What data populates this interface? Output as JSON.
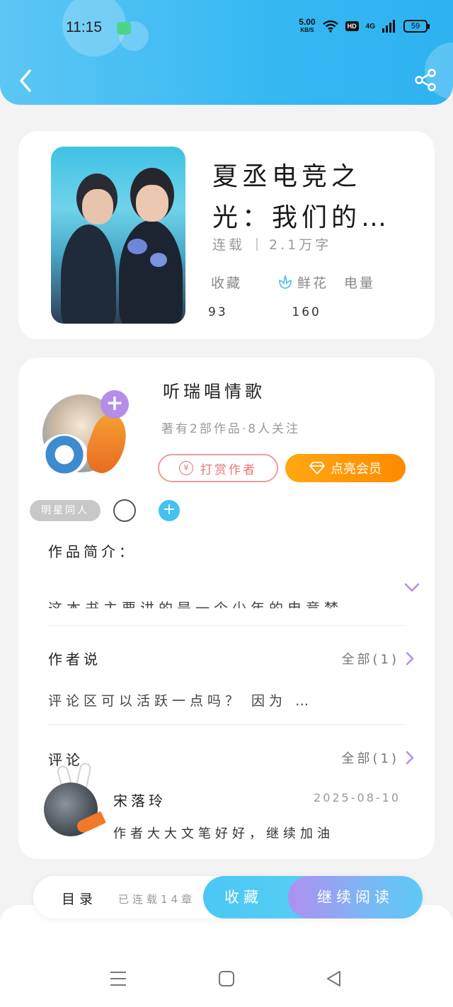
{
  "status_bar": {
    "time": "11:15",
    "net_speed": "5.00",
    "net_unit": "KB/S",
    "hd": "HD",
    "signal": "4G",
    "battery": "59"
  },
  "book": {
    "title": "夏丞电竞之光：我们的电竞梦",
    "status": "连载",
    "word_count": "2.1万字",
    "stats": {
      "collect_label": "收藏",
      "flower_label": "鲜花",
      "power_label": "电量",
      "collect_value": "93",
      "flower_value": "160"
    }
  },
  "author": {
    "name": "听瑞唱情歌",
    "info": "著有2部作品·8人关注",
    "reward_label": "打赏作者",
    "vip_label": "点亮会员"
  },
  "tags": [
    "明星同人"
  ],
  "intro": {
    "title": "作品简介：",
    "text": "这本书主要讲的是一个少年的电竞梦"
  },
  "author_say": {
    "title": "作者说",
    "all_label": "全部(1)",
    "text": "评论区可以活跃一点吗？ 因为 …"
  },
  "comments": {
    "title": "评论",
    "all_label": "全部(1)",
    "items": [
      {
        "user": "宋落玲",
        "date": "2025-08-10",
        "text": "作者大大文笔好好，继续加油"
      }
    ]
  },
  "action_bar": {
    "toc_label": "目录",
    "serial_text": "已连载14章",
    "fav_label": "收藏",
    "read_label": "继续阅读"
  },
  "colors": {
    "header": "#36b8f2",
    "accent_blue": "#4bc7f4",
    "vip_orange": "#ff9a08",
    "purple": "#b48de9"
  }
}
